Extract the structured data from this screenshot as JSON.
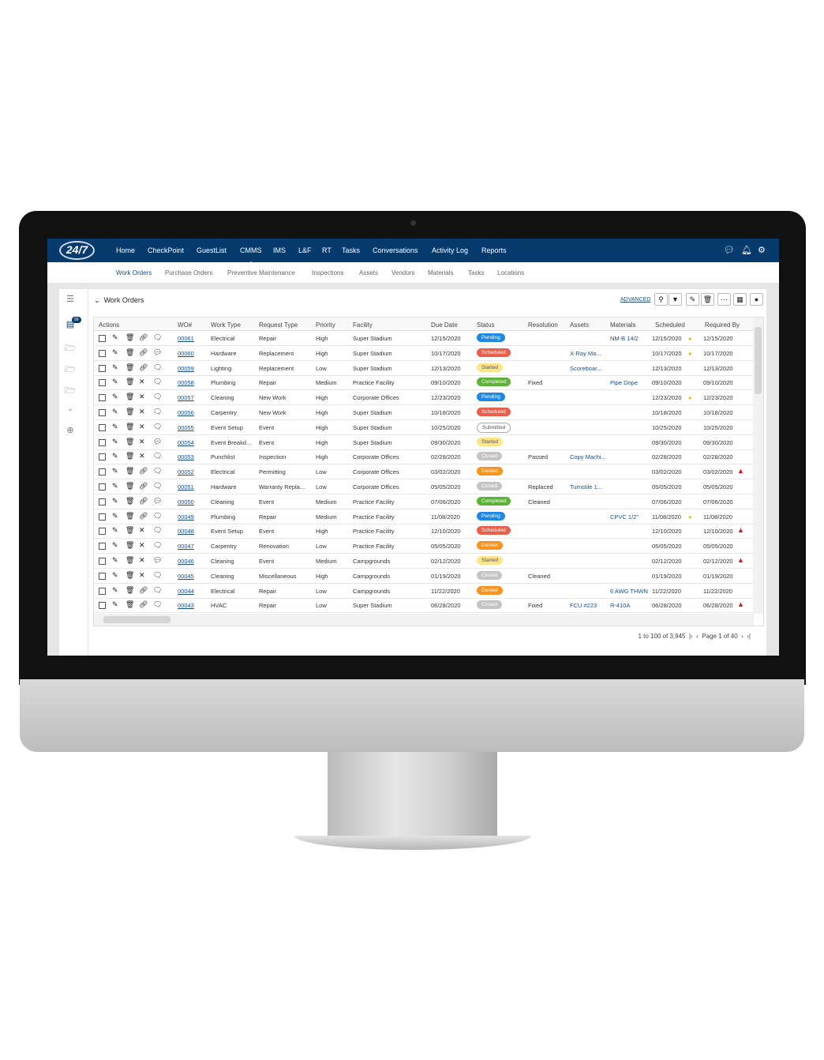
{
  "topnav": {
    "logo": "24/7",
    "items": [
      "Home",
      "CheckPoint",
      "GuestList",
      "CMMS",
      "IMS",
      "L&F",
      "RT",
      "Tasks",
      "Conversations",
      "Activity Log",
      "Reports"
    ],
    "active": "CMMS",
    "icons": [
      "chat-icon",
      "bell-icon",
      "gear-icon"
    ]
  },
  "subnav": {
    "items": [
      "Work Orders",
      "Purchase Orders",
      "Preventive Maintenance",
      "Inspections",
      "Assets",
      "Vendors",
      "Materials",
      "Tasks",
      "Locations"
    ],
    "active": "Work Orders"
  },
  "sidebar": {
    "badge": "99",
    "icons": [
      "menu-icon",
      "list-icon",
      "folder-icon",
      "folder-icon",
      "folder-icon",
      "chevron-down-icon",
      "add-circle-icon"
    ]
  },
  "panel": {
    "title": "Work Orders",
    "advanced": "ADVANCED",
    "toolbar": [
      "search-icon",
      "filter-icon",
      "edit-icon",
      "trash-icon",
      "more-icon",
      "calendar-icon",
      "add-icon"
    ]
  },
  "table": {
    "columns": [
      "Actions",
      "WO#",
      "Work Type",
      "Request Type",
      "Priority",
      "Facility",
      "Due Date",
      "Status",
      "Resolution",
      "Assets",
      "Materials",
      "Scheduled",
      "Required By"
    ],
    "status_colors": {
      "Pending": "#1e88e5",
      "Scheduled": "#e8604c",
      "Started": "#fde68a",
      "Completed": "#5cb338",
      "Submitted": "#ffffff",
      "Closed": "#c4c4c4",
      "Denied": "#f7931e"
    },
    "rows": [
      {
        "wo": "00061",
        "work": "Electrical",
        "req": "Repair",
        "pri": "High",
        "fac": "Super Stadium",
        "due": "12/15/2020",
        "status": "Pending",
        "res": "",
        "assets": "",
        "mat": "NM-B 14/2",
        "sched": "12/15/2020",
        "req_by": "12/15/2020",
        "linked": true,
        "comment": false,
        "sched_flag": "clock",
        "req_flag": ""
      },
      {
        "wo": "00060",
        "work": "Hardware",
        "req": "Replacement",
        "pri": "High",
        "fac": "Super Stadium",
        "due": "10/17/2020",
        "status": "Scheduled",
        "res": "",
        "assets": "X-Ray Ma...",
        "mat": "",
        "sched": "10/17/2020",
        "req_by": "10/17/2020",
        "linked": true,
        "comment": true,
        "sched_flag": "clock",
        "req_flag": ""
      },
      {
        "wo": "00059",
        "work": "Lighting",
        "req": "Replacement",
        "pri": "Low",
        "fac": "Super Stadium",
        "due": "12/13/2020",
        "status": "Started",
        "res": "",
        "assets": "Scoreboar...",
        "mat": "",
        "sched": "12/13/2020",
        "req_by": "12/13/2020",
        "linked": true,
        "comment": false,
        "sched_flag": "",
        "req_flag": ""
      },
      {
        "wo": "00058",
        "work": "Plumbing",
        "req": "Repair",
        "pri": "Medium",
        "fac": "Practice Facility",
        "due": "09/10/2020",
        "status": "Completed",
        "res": "Fixed",
        "assets": "",
        "mat": "Pipe Dope",
        "sched": "09/10/2020",
        "req_by": "09/10/2020",
        "linked": false,
        "comment": false,
        "sched_flag": "",
        "req_flag": ""
      },
      {
        "wo": "00057",
        "work": "Cleaning",
        "req": "New Work",
        "pri": "High",
        "fac": "Corporate Offices",
        "due": "12/23/2020",
        "status": "Pending",
        "res": "",
        "assets": "",
        "mat": "",
        "sched": "12/23/2020",
        "req_by": "12/23/2020",
        "linked": false,
        "comment": false,
        "sched_flag": "clock",
        "req_flag": ""
      },
      {
        "wo": "00056",
        "work": "Carpentry",
        "req": "New Work",
        "pri": "High",
        "fac": "Super Stadium",
        "due": "10/18/2020",
        "status": "Scheduled",
        "res": "",
        "assets": "",
        "mat": "",
        "sched": "10/18/2020",
        "req_by": "10/18/2020",
        "linked": false,
        "comment": false,
        "sched_flag": "",
        "req_flag": ""
      },
      {
        "wo": "00055",
        "work": "Event Setup",
        "req": "Event",
        "pri": "High",
        "fac": "Super Stadium",
        "due": "10/25/2020",
        "status": "Submitted",
        "res": "",
        "assets": "",
        "mat": "",
        "sched": "10/25/2020",
        "req_by": "10/25/2020",
        "linked": false,
        "comment": false,
        "sched_flag": "",
        "req_flag": ""
      },
      {
        "wo": "00054",
        "work": "Event Breakd...",
        "req": "Event",
        "pri": "High",
        "fac": "Super Stadium",
        "due": "09/30/2020",
        "status": "Started",
        "res": "",
        "assets": "",
        "mat": "",
        "sched": "09/30/2020",
        "req_by": "09/30/2020",
        "linked": false,
        "comment": true,
        "sched_flag": "",
        "req_flag": ""
      },
      {
        "wo": "00053",
        "work": "Punchlist",
        "req": "Inspection",
        "pri": "High",
        "fac": "Corporate Offices",
        "due": "02/28/2020",
        "status": "Closed",
        "res": "Passed",
        "assets": "Copy Machi...",
        "mat": "",
        "sched": "02/28/2020",
        "req_by": "02/28/2020",
        "linked": false,
        "comment": false,
        "sched_flag": "",
        "req_flag": ""
      },
      {
        "wo": "00052",
        "work": "Electrical",
        "req": "Permitting",
        "pri": "Low",
        "fac": "Corporate Offices",
        "due": "03/02/2020",
        "status": "Denied",
        "res": "",
        "assets": "",
        "mat": "",
        "sched": "03/02/2020",
        "req_by": "03/02/2020",
        "linked": true,
        "comment": false,
        "sched_flag": "",
        "req_flag": "warning"
      },
      {
        "wo": "00051",
        "work": "Hardware",
        "req": "Warranty Repla...",
        "pri": "Low",
        "fac": "Corporate Offices",
        "due": "05/05/2020",
        "status": "Closed",
        "res": "Replaced",
        "assets": "Turnstile 1...",
        "mat": "",
        "sched": "05/05/2020",
        "req_by": "05/05/2020",
        "linked": true,
        "comment": false,
        "sched_flag": "",
        "req_flag": ""
      },
      {
        "wo": "00050",
        "work": "Cleaning",
        "req": "Event",
        "pri": "Medium",
        "fac": "Practice Facility",
        "due": "07/06/2020",
        "status": "Completed",
        "res": "Cleaned",
        "assets": "",
        "mat": "",
        "sched": "07/06/2020",
        "req_by": "07/06/2020",
        "linked": true,
        "comment": true,
        "sched_flag": "",
        "req_flag": ""
      },
      {
        "wo": "00049",
        "work": "Plumbing",
        "req": "Repair",
        "pri": "Medium",
        "fac": "Practice Facility",
        "due": "11/08/2020",
        "status": "Pending",
        "res": "",
        "assets": "",
        "mat": "CPVC 1/2\"",
        "sched": "11/08/2020",
        "req_by": "11/08/2020",
        "linked": true,
        "comment": false,
        "sched_flag": "clock",
        "req_flag": ""
      },
      {
        "wo": "00048",
        "work": "Event Setup",
        "req": "Event",
        "pri": "High",
        "fac": "Practice Facility",
        "due": "12/10/2020",
        "status": "Scheduled",
        "res": "",
        "assets": "",
        "mat": "",
        "sched": "12/10/2020",
        "req_by": "12/10/2020",
        "linked": false,
        "comment": false,
        "sched_flag": "",
        "req_flag": "warning"
      },
      {
        "wo": "00047",
        "work": "Carpentry",
        "req": "Renovation",
        "pri": "Low",
        "fac": "Practice Facility",
        "due": "05/05/2020",
        "status": "Denied",
        "res": "",
        "assets": "",
        "mat": "",
        "sched": "05/05/2020",
        "req_by": "05/05/2020",
        "linked": false,
        "comment": false,
        "sched_flag": "",
        "req_flag": ""
      },
      {
        "wo": "00046",
        "work": "Cleaning",
        "req": "Event",
        "pri": "Medium",
        "fac": "Campgrounds",
        "due": "02/12/2020",
        "status": "Started",
        "res": "",
        "assets": "",
        "mat": "",
        "sched": "02/12/2020",
        "req_by": "02/12/2020",
        "linked": false,
        "comment": true,
        "sched_flag": "",
        "req_flag": "warning"
      },
      {
        "wo": "00045",
        "work": "Cleaning",
        "req": "Miscellaneous",
        "pri": "High",
        "fac": "Campgrounds",
        "due": "01/19/2020",
        "status": "Closed",
        "res": "Cleaned",
        "assets": "",
        "mat": "",
        "sched": "01/19/2020",
        "req_by": "01/19/2020",
        "linked": false,
        "comment": false,
        "sched_flag": "",
        "req_flag": ""
      },
      {
        "wo": "00044",
        "work": "Electrical",
        "req": "Repair",
        "pri": "Low",
        "fac": "Campgrounds",
        "due": "11/22/2020",
        "status": "Denied",
        "res": "",
        "assets": "",
        "mat": "6 AWG THWN",
        "sched": "11/22/2020",
        "req_by": "11/22/2020",
        "linked": true,
        "comment": false,
        "sched_flag": "",
        "req_flag": ""
      },
      {
        "wo": "00043",
        "work": "HVAC",
        "req": "Repair",
        "pri": "Low",
        "fac": "Super Stadium",
        "due": "06/28/2020",
        "status": "Closed",
        "res": "Fixed",
        "assets": "FCU #223",
        "mat": "R-410A",
        "sched": "06/28/2020",
        "req_by": "06/28/2020",
        "linked": true,
        "comment": false,
        "sched_flag": "",
        "req_flag": "warning"
      }
    ]
  },
  "pager": {
    "range": "1 to 100 of 3,945",
    "page": "Page 1 of 40"
  }
}
